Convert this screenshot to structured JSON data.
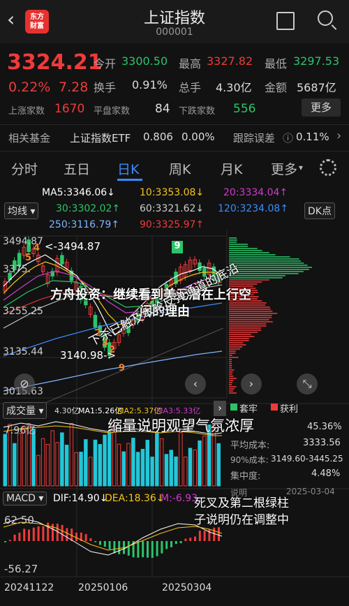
{
  "header": {
    "back_icon": "chevron-left-icon",
    "logo_text_1": "东方",
    "logo_text_2": "财富",
    "title": "上证指数",
    "code": "000001",
    "share_icon": "share-icon",
    "search_icon": "search-icon"
  },
  "quote": {
    "price": "3324.21",
    "change_pct": "0.22%",
    "change": "7.28",
    "open_label": "今开",
    "open": "3300.50",
    "high_label": "最高",
    "high": "3327.82",
    "low_label": "最低",
    "low": "3297.53",
    "turnover_label": "换手",
    "turnover": "0.91%",
    "volume_label": "总手",
    "volume": "4.30亿",
    "amount_label": "金额",
    "amount": "5687亿",
    "up_label": "上涨家数",
    "up": "1670",
    "flat_label": "平盘家数",
    "flat": "84",
    "down_label": "下跌家数",
    "down": "556",
    "more_label": "更多"
  },
  "fund": {
    "label": "相关基金",
    "name": "上证指数ETF",
    "price": "0.806",
    "pct": "0.00%",
    "tracking_label": "跟踪误差",
    "tracking": "0.11%",
    "arrow": "›"
  },
  "tabs": [
    "分时",
    "五日",
    "日K",
    "周K",
    "月K",
    "更多"
  ],
  "tabs_more_arrow": "▾",
  "settings_icon": "gear-icon",
  "ma": {
    "ma5": "MA5:3346.06↓",
    "ma10": "10:3353.08↓",
    "ma20": "20:3334.04↑",
    "ma30": "30:3302.02↑",
    "ma60": "60:3321.62↓",
    "ma120": "120:3234.08↑",
    "ma250": "250:3116.79↑",
    "ma90": "90:3325.97↑",
    "indicator": "均线",
    "dk": "DK点"
  },
  "kline": {
    "high_label": "3494.87",
    "high_arrow_label": "<-3494.87",
    "mid_label": "3375.",
    "low_axis_1": "3255.25",
    "low_axis_2": "3135.44",
    "low_axis_3": "3015.63",
    "low_pointer": "3140.98->",
    "marker_9": "9",
    "marker_nums": [
      "5",
      "4",
      "2",
      "3",
      "2",
      "9"
    ]
  },
  "volume": {
    "label": "成交量",
    "vol": "4.30亿",
    "ma1": "MA1:5.26亿",
    "ma2": "MA2:5.37亿",
    "ma3": "MA3:5.33亿",
    "axis_top": "7.96亿"
  },
  "chip": {
    "legend_a": "套牢",
    "legend_b": "获利",
    "pct_value": "45.36%",
    "avg_label": "平均成本:",
    "avg_value": "3333.56",
    "range_label": "90%成本:",
    "range_value": "3149.60-3445.25",
    "conc_label": "集中度:",
    "conc_value": "4.48%",
    "desc_label": "说明",
    "date": "2025-03-04"
  },
  "macd": {
    "label": "MACD",
    "dif": "DIF:14.90↓",
    "dea": "DEA:18.36↓",
    "m": "M:-6.93",
    "axis_top": "62.50",
    "axis_bottom": "-56.27"
  },
  "dates": [
    "20241122",
    "20250106",
    "20250304"
  ],
  "annotations": {
    "headline_1": "方舟投资：继续看到美元潜在上行空",
    "headline_2": "间的理由",
    "diagonal": "下杀已触及本轮反弹通道的底沿",
    "vol_note": "缩量说明观望气氛浓厚",
    "macd_note_1": "死叉及第二根绿柱",
    "macd_note_2": "子说明仍在调整中"
  },
  "nav": {
    "zoom_out": "⊘",
    "left": "‹",
    "right": "›",
    "fit": "⤡"
  },
  "colors": {
    "up": "#f03a3a",
    "down": "#2cc46a",
    "accent": "#3a8cff",
    "bg": "#121212"
  }
}
